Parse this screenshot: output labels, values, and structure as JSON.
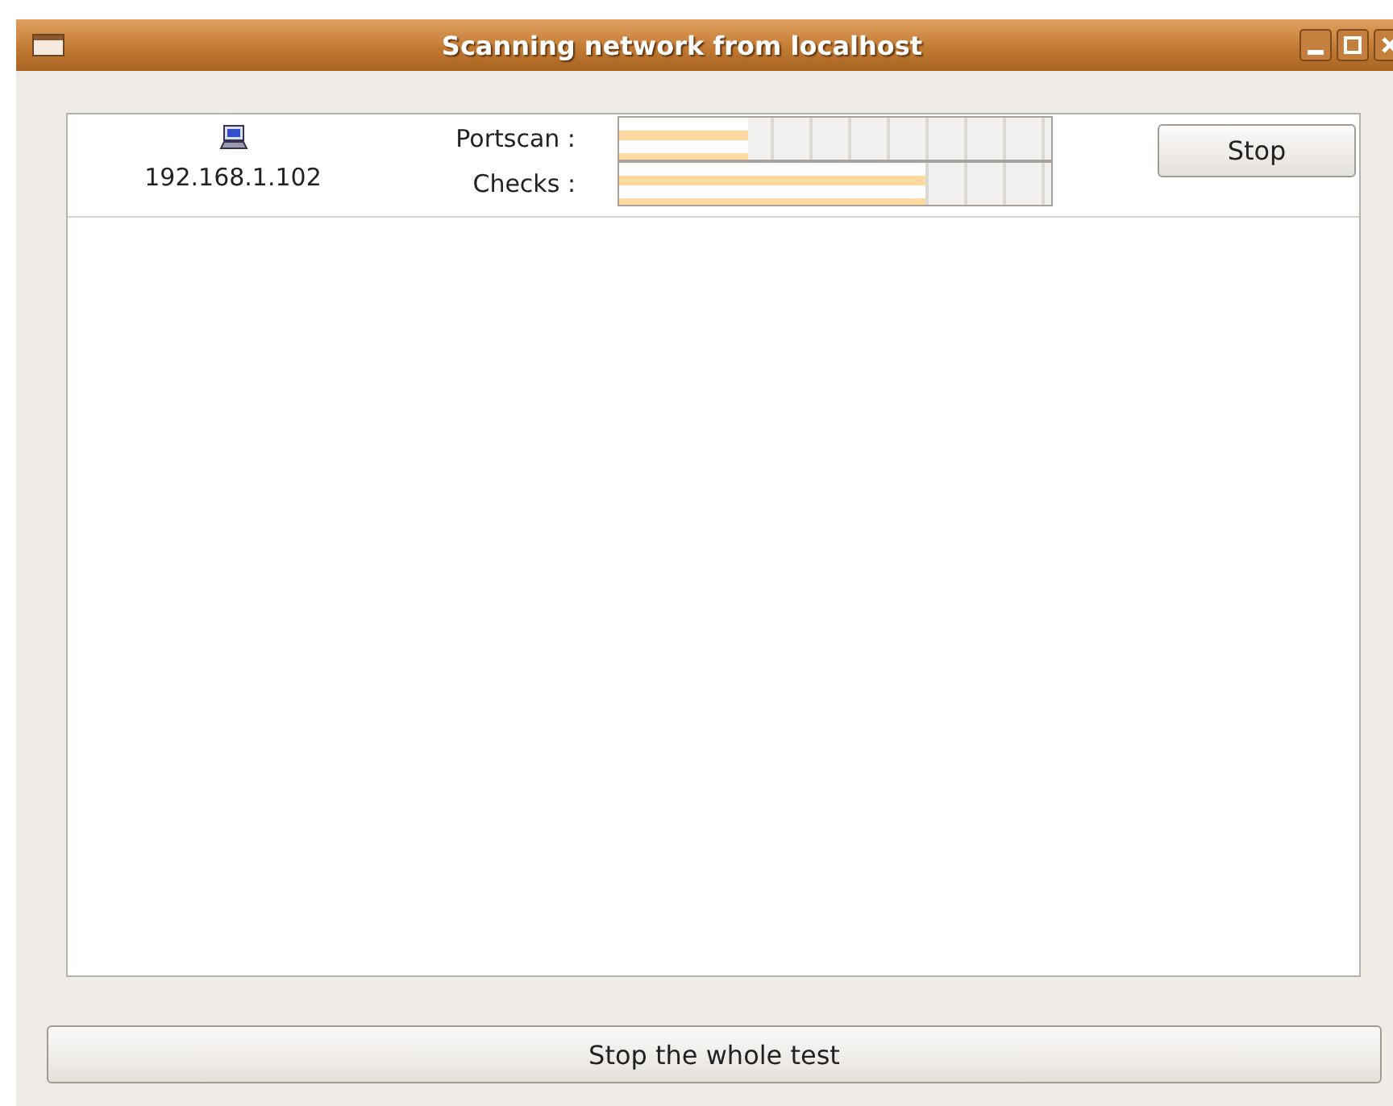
{
  "window": {
    "title": "Scanning network from localhost"
  },
  "host": {
    "address": "192.168.1.102"
  },
  "progress": [
    {
      "label": "Portscan :",
      "level": 0.3
    },
    {
      "label": "Checks :",
      "level": 0.71
    }
  ],
  "stop_button": "Stop",
  "stop_all_button": "Stop the whole test"
}
